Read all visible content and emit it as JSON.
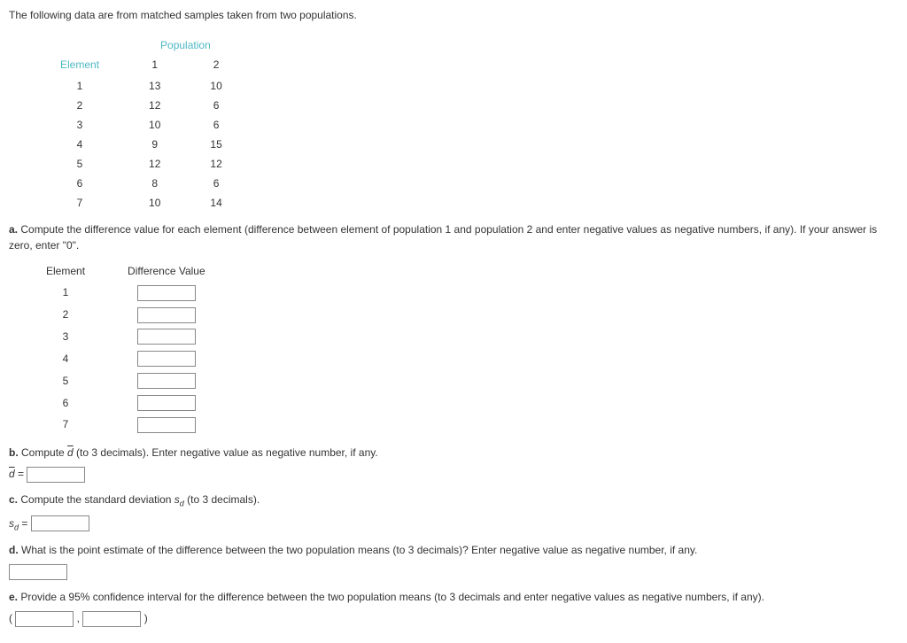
{
  "intro": "The following data are from matched samples taken from two populations.",
  "table1": {
    "popHeader": "Population",
    "elementLabel": "Element",
    "col1": "1",
    "col2": "2",
    "rows": [
      {
        "el": "1",
        "p1": "13",
        "p2": "10"
      },
      {
        "el": "2",
        "p1": "12",
        "p2": "6"
      },
      {
        "el": "3",
        "p1": "10",
        "p2": "6"
      },
      {
        "el": "4",
        "p1": "9",
        "p2": "15"
      },
      {
        "el": "5",
        "p1": "12",
        "p2": "12"
      },
      {
        "el": "6",
        "p1": "8",
        "p2": "6"
      },
      {
        "el": "7",
        "p1": "10",
        "p2": "14"
      }
    ]
  },
  "partA": {
    "label": "a.",
    "text": " Compute the difference value for each element (difference between element of population 1 and population 2 and enter negative values as negative numbers, if any). If your answer is zero, enter \"0\".",
    "col1": "Element",
    "col2": "Difference Value",
    "elements": [
      "1",
      "2",
      "3",
      "4",
      "5",
      "6",
      "7"
    ]
  },
  "partB": {
    "label": "b.",
    "text_pre": " Compute ",
    "dbar": "d",
    "text_post": " (to 3 decimals). Enter negative value as negative number, if any.",
    "formula_sym": "d",
    "equals": " ="
  },
  "partC": {
    "label": "c.",
    "text_pre": " Compute the standard deviation ",
    "sd_sym": "s",
    "sd_sub": "d",
    "text_post": " (to 3 decimals).",
    "equals": " ="
  },
  "partD": {
    "label": "d.",
    "text": " What is the point estimate of the difference between the two population means (to 3 decimals)? Enter negative value as negative number, if any."
  },
  "partE": {
    "label": "e.",
    "text_pre": " Provide a ",
    "pct": "95%",
    "text_post": " confidence interval for the difference between the two population means (to 3 decimals and enter negative values as negative numbers, if any).",
    "open": "(",
    "comma": " , ",
    "close": ")"
  }
}
